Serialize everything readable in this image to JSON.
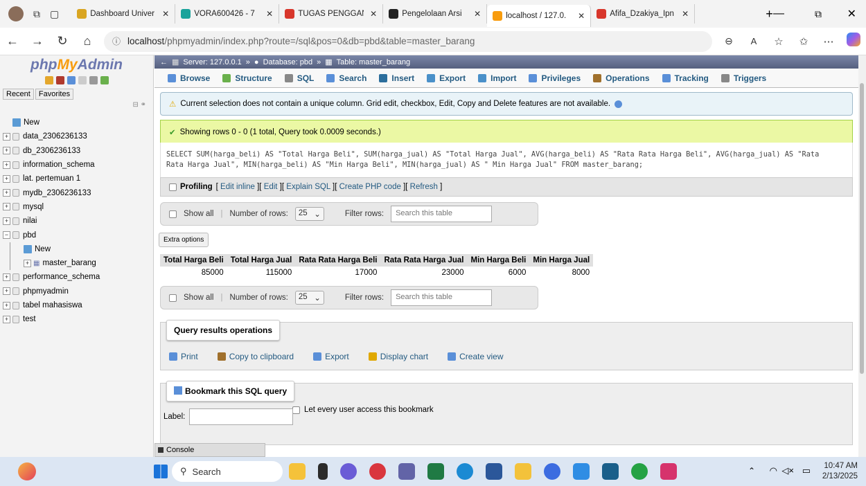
{
  "browser": {
    "tabs": [
      {
        "label": "Dashboard Univer",
        "color": "#d9a521"
      },
      {
        "label": "VORA600426 - 7",
        "color": "#1aa39b"
      },
      {
        "label": "TUGAS PENGGAN",
        "color": "#d8372c"
      },
      {
        "label": "Pengelolaan Arsi",
        "color": "#222222"
      },
      {
        "label": "localhost / 127.0.",
        "color": "#f89c0e",
        "active": true
      },
      {
        "label": "Afifa_Dzakiya_Ipn",
        "color": "#d8372c"
      }
    ],
    "url_host": "localhost",
    "url_path": "/phpmyadmin/index.php?route=/sql&pos=0&db=pbd&table=master_barang"
  },
  "sidebar": {
    "logo_php": "php",
    "logo_my": "My",
    "logo_admin": "Admin",
    "recent": "Recent",
    "favorites": "Favorites",
    "items": [
      {
        "label": "New",
        "level": 0
      },
      {
        "label": "data_2306236133",
        "level": 0
      },
      {
        "label": "db_2306236133",
        "level": 0
      },
      {
        "label": "information_schema",
        "level": 0
      },
      {
        "label": "lat. pertemuan 1",
        "level": 0
      },
      {
        "label": "mydb_2306236133",
        "level": 0
      },
      {
        "label": "mysql",
        "level": 0
      },
      {
        "label": "nilai",
        "level": 0
      },
      {
        "label": "pbd",
        "level": 0
      },
      {
        "label": "New",
        "level": 1
      },
      {
        "label": "master_barang",
        "level": 1
      },
      {
        "label": "performance_schema",
        "level": 0
      },
      {
        "label": "phpmyadmin",
        "level": 0
      },
      {
        "label": "tabel mahasiswa",
        "level": 0
      },
      {
        "label": "test",
        "level": 0
      }
    ]
  },
  "breadcrumb": {
    "server": "Server: 127.0.0.1",
    "database": "Database: pbd",
    "table": "Table: master_barang"
  },
  "tabs": [
    "Browse",
    "Structure",
    "SQL",
    "Search",
    "Insert",
    "Export",
    "Import",
    "Privileges",
    "Operations",
    "Tracking",
    "Triggers"
  ],
  "notice": "Current selection does not contain a unique column. Grid edit, checkbox, Edit, Copy and Delete features are not available.",
  "success": "Showing rows 0 - 0 (1 total, Query took 0.0009 seconds.)",
  "sql_line1": "SELECT SUM(harga_beli) AS \"Total Harga Beli\", SUM(harga_jual) AS \"Total Harga Jual\", AVG(harga_beli) AS \"Rata Rata Harga Beli\", AVG(harga_jual) AS \"Rata",
  "sql_line2": "Rata Harga Jual\", MIN(harga_beli) AS \"Min Harga Beli\", MIN(harga_jual) AS \" Min Harga Jual\" FROM master_barang;",
  "profiling": {
    "label": "Profiling",
    "links": [
      "Edit inline",
      "Edit",
      "Explain SQL",
      "Create PHP code",
      "Refresh"
    ]
  },
  "nav": {
    "show_all": "Show all",
    "rows_label": "Number of rows:",
    "rows_value": "25",
    "filter_label": "Filter rows:",
    "filter_placeholder": "Search this table"
  },
  "extra_options": "Extra options",
  "results": {
    "columns": [
      "Total Harga Beli",
      "Total Harga Jual",
      "Rata Rata Harga Beli",
      "Rata Rata Harga Jual",
      "Min Harga Beli",
      "Min Harga Jual"
    ],
    "rows": [
      [
        "85000",
        "115000",
        "17000",
        "23000",
        "6000",
        "8000"
      ]
    ]
  },
  "qro": {
    "title": "Query results operations",
    "links": [
      "Print",
      "Copy to clipboard",
      "Export",
      "Display chart",
      "Create view"
    ]
  },
  "bookmark": {
    "title": "Bookmark this SQL query",
    "label": "Label:",
    "access": "Let every user access this bookmark"
  },
  "console": "Console",
  "taskbar": {
    "search": "Search",
    "time": "10:47 AM",
    "date": "2/13/2025"
  }
}
